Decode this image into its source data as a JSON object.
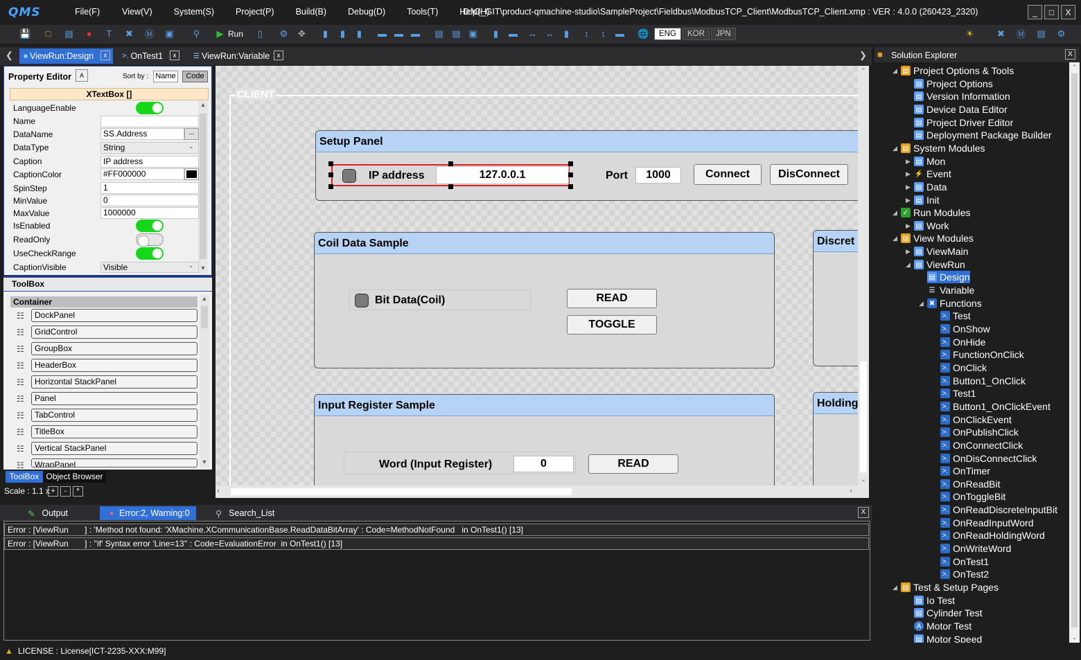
{
  "app": {
    "logo": "QMS",
    "title": "D:\\O_GIT\\product-qmachine-studio\\SampleProject\\Fieldbus\\ModbusTCP_Client\\ModbusTCP_Client.xmp :  VER : 4.0.0 (260423_2320)",
    "menu": [
      "File(F)",
      "View(V)",
      "System(S)",
      "Project(P)",
      "Build(B)",
      "Debug(D)",
      "Tools(T)",
      "Help(H)"
    ],
    "window_buttons": [
      "_",
      "□",
      "X"
    ]
  },
  "toolbar": {
    "run_label": "Run",
    "languages": [
      "ENG",
      "KOR",
      "JPN"
    ],
    "active_language": "ENG"
  },
  "doc_tabs": [
    {
      "label": "ViewRun:Design",
      "active": true
    },
    {
      "label": "OnTest1",
      "active": false
    },
    {
      "label": "ViewRun:Variable",
      "active": false
    }
  ],
  "property_editor": {
    "title": "Property Editor",
    "sort_by_label": "Sort by :",
    "sort_name": "Name",
    "sort_code": "Code",
    "object_title": "XTextBox []",
    "rows": [
      {
        "label": "LanguageEnable",
        "toggle": true
      },
      {
        "label": "Name",
        "value": ""
      },
      {
        "label": "DataName",
        "value": "SS.Address"
      },
      {
        "label": "DataType",
        "value": "String"
      },
      {
        "label": "Caption",
        "value": "IP address"
      },
      {
        "label": "CaptionColor",
        "value": "#FF000000"
      },
      {
        "label": "SpinStep",
        "value": "1"
      },
      {
        "label": "MinValue",
        "value": "0"
      },
      {
        "label": "MaxValue",
        "value": "1000000"
      },
      {
        "label": "IsEnabled",
        "toggle": true
      },
      {
        "label": "ReadOnly",
        "toggle": false
      },
      {
        "label": "UseCheckRange",
        "toggle": true
      },
      {
        "label": "CaptionVisible",
        "value": "Visible"
      }
    ],
    "ellipsis": "..."
  },
  "toolbox": {
    "title": "ToolBox",
    "category": "Container",
    "items": [
      "DockPanel",
      "GridControl",
      "GroupBox",
      "HeaderBox",
      "Horizontal StackPanel",
      "Panel",
      "TabControl",
      "TitleBox",
      "Vertical StackPanel",
      "WrapPanel"
    ],
    "tabs": [
      "ToolBox",
      "Object Browser"
    ],
    "scale_label": "Scale : 1.1 x",
    "scale_buttons": [
      "+",
      "-",
      "*"
    ]
  },
  "canvas": {
    "client_label": "CLIENT",
    "setup_panel": {
      "title": "Setup Panel",
      "ip_label": "IP address",
      "ip_value": "127.0.0.1",
      "port_label": "Port",
      "port_value": "1000",
      "connect": "Connect",
      "disconnect": "DisConnect"
    },
    "coil_panel": {
      "title": "Coil Data  Sample",
      "bit_label": "Bit Data(Coil)",
      "read": "READ",
      "toggle": "TOGGLE"
    },
    "discrete_panel": {
      "title": "Discret"
    },
    "input_panel": {
      "title": "Input Register Sample",
      "word_label": "Word (Input Register)",
      "word_value": "0",
      "read": "READ"
    },
    "holding_panel": {
      "title": "Holding"
    }
  },
  "output": {
    "tabs": [
      "Output",
      "Error:2, Warning:0",
      "Search_List"
    ],
    "errors": [
      "Error : [ViewRun       ] : 'Method not found: 'XMachine.XCommunicationBase.ReadDataBitArray' : Code=MethodNotFound   in OnTest1() [13]",
      "Error : [ViewRun       ] : ''if' Syntax error 'Line=13'' : Code=EvaluationError  in OnTest1() [13]"
    ],
    "close": "X"
  },
  "status": {
    "license": "LICENSE : License[ICT-2235-XXX:M99]"
  },
  "solution_explorer": {
    "title": "Solution Explorer",
    "close": "X",
    "nodes": [
      {
        "label": "Project Options & Tools",
        "level": 0
      },
      {
        "label": "Project Options",
        "level": 1
      },
      {
        "label": "Version Information",
        "level": 1
      },
      {
        "label": "Device Data Editor",
        "level": 1
      },
      {
        "label": "Project Driver Editor",
        "level": 1
      },
      {
        "label": "Deployment Package Builder",
        "level": 1
      },
      {
        "label": "System Modules",
        "level": 0
      },
      {
        "label": "Mon",
        "level": 1
      },
      {
        "label": "Event",
        "level": 1
      },
      {
        "label": "Data",
        "level": 1
      },
      {
        "label": "Init",
        "level": 1
      },
      {
        "label": "Run Modules",
        "level": 0
      },
      {
        "label": "Work",
        "level": 1
      },
      {
        "label": "View Modules",
        "level": 0
      },
      {
        "label": "ViewMain",
        "level": 1
      },
      {
        "label": "ViewRun",
        "level": 1
      },
      {
        "label": "Design",
        "level": 2
      },
      {
        "label": "Variable",
        "level": 2
      },
      {
        "label": "Functions",
        "level": 2
      },
      {
        "label": "Test",
        "level": 3
      },
      {
        "label": "OnShow",
        "level": 3
      },
      {
        "label": "OnHide",
        "level": 3
      },
      {
        "label": "FunctionOnClick",
        "level": 3
      },
      {
        "label": "OnClick",
        "level": 3
      },
      {
        "label": "Button1_OnClick",
        "level": 3
      },
      {
        "label": "Test1",
        "level": 3
      },
      {
        "label": "Button1_OnClickEvent",
        "level": 3
      },
      {
        "label": "OnClickEvent",
        "level": 3
      },
      {
        "label": "OnPublishClick",
        "level": 3
      },
      {
        "label": "OnConnectClick",
        "level": 3
      },
      {
        "label": "OnDisConnectClick",
        "level": 3
      },
      {
        "label": "OnTimer",
        "level": 3
      },
      {
        "label": "OnReadBit",
        "level": 3
      },
      {
        "label": "OnToggleBit",
        "level": 3
      },
      {
        "label": "OnReadDiscreteInputBit",
        "level": 3
      },
      {
        "label": "OnReadInputWord",
        "level": 3
      },
      {
        "label": "OnReadHoldingWord",
        "level": 3
      },
      {
        "label": "OnWriteWord",
        "level": 3
      },
      {
        "label": "OnTest1",
        "level": 3
      },
      {
        "label": "OnTest2",
        "level": 3
      },
      {
        "label": "Test & Setup Pages",
        "level": 0
      },
      {
        "label": "Io Test",
        "level": 1
      },
      {
        "label": "Cylinder Test",
        "level": 1
      },
      {
        "label": "Motor Test",
        "level": 1
      },
      {
        "label": "Motor Speed",
        "level": 1
      }
    ]
  },
  "colors": {
    "accent": "#2f6fd6",
    "toggle_on": "#17d71b",
    "panel_header": "#b6d3f5",
    "selection_border": "#e02020"
  }
}
